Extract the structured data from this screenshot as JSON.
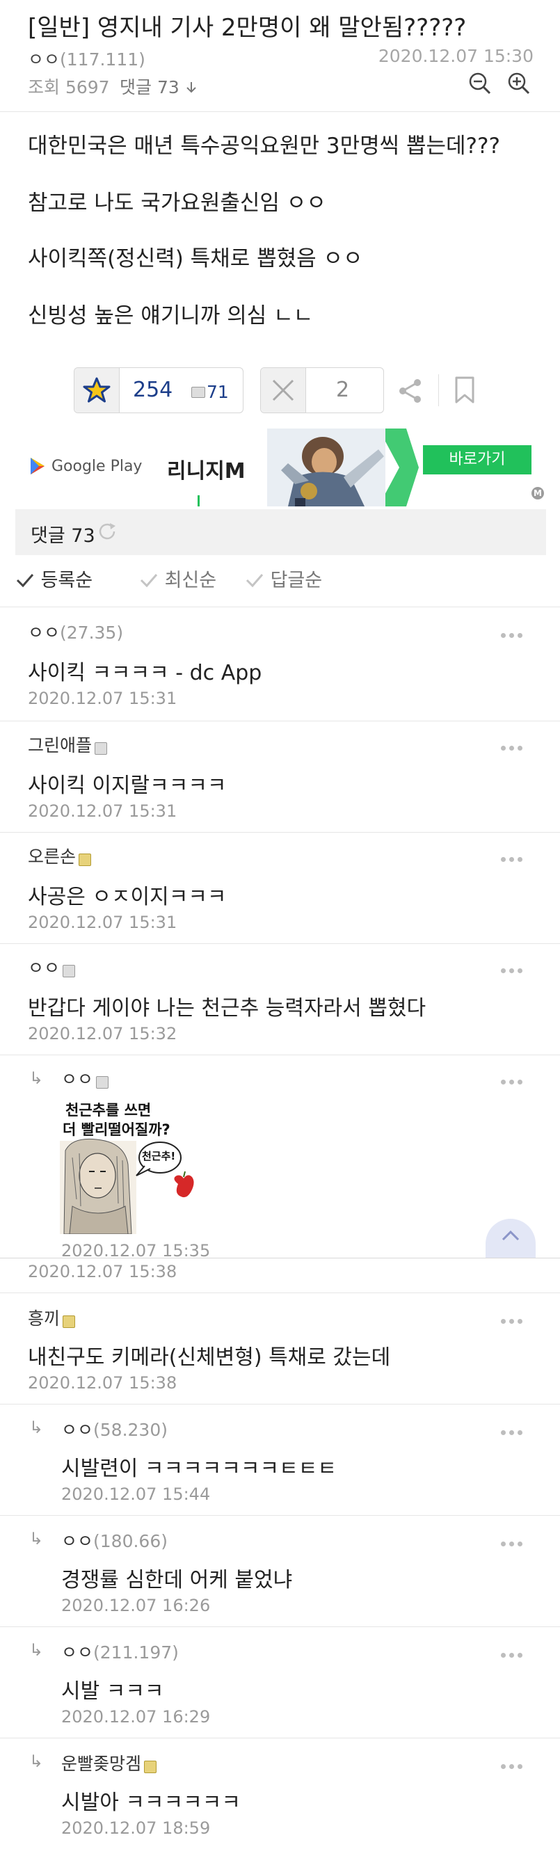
{
  "post": {
    "title": "[일반] 영지내 기사 2만명이 왜 말안됨?????",
    "author_name": "ㅇㅇ",
    "author_ip": "(117.111)",
    "datetime": "2020.12.07 15:30",
    "views": "조회 5697",
    "comment_count_link": "댓글 73",
    "body_lines": [
      "대한민국은 매년 특수공익요원만 3만명씩 뽑는데???",
      "참고로 나도 국가요원출신임 ㅇㅇ",
      "사이킥쪽(정신력) 특채로 뽑혔음 ㅇㅇ",
      "신빙성 높은 얘기니까 의심 ㄴㄴ"
    ]
  },
  "votes": {
    "up_count": "254",
    "fix_count": "71",
    "down_count": "2"
  },
  "ad": {
    "store": "Google Play",
    "title": "리니지M",
    "cta": "바로가기"
  },
  "comments_header": {
    "label": "댓글 73"
  },
  "sort": {
    "options": [
      "등록순",
      "최신순",
      "답글순"
    ]
  },
  "image_comment": {
    "caption_line1": "천근추를 쓰면",
    "caption_line2": "더 빨리떨어질까?",
    "bubble": "천근추!",
    "date": "2020.12.07 15:35",
    "parent_date": "2020.12.07 15:38"
  },
  "comments": [
    {
      "author": "ㅇㅇ",
      "ip": "(27.35)",
      "text": "사이킥 ㅋㅋㅋㅋ - dc App",
      "date": "2020.12.07 15:31",
      "reply": false
    },
    {
      "author": "그린애플",
      "ip": "",
      "text": "사이킥 이지랄ㅋㅋㅋㅋ",
      "date": "2020.12.07 15:31",
      "reply": false
    },
    {
      "author": "오른손",
      "ip": "",
      "text": "사공은 ㅇㅈ이지ㅋㅋㅋ",
      "date": "2020.12.07 15:31",
      "reply": false
    },
    {
      "author": "ㅇㅇ",
      "ip": "",
      "text": "반갑다 게이야 나는 천근추 능력자라서 뽑혔다",
      "date": "2020.12.07 15:32",
      "reply": false
    },
    {
      "author": "ㅇㅇ",
      "ip": "",
      "text": "",
      "date": "",
      "reply": true
    },
    {
      "author": "흥끼",
      "ip": "",
      "text": "내친구도 키메라(신체변형) 특채로 갔는데",
      "date": "2020.12.07 15:38",
      "reply": false
    },
    {
      "author": "ㅇㅇ",
      "ip": "(58.230)",
      "text": "시발련이 ㅋㅋㅋㅋㅋㅋㅋㅌㅌㅌ",
      "date": "2020.12.07 15:44",
      "reply": true
    },
    {
      "author": "ㅇㅇ",
      "ip": "(180.66)",
      "text": "경쟁률 심한데 어케 붙었냐",
      "date": "2020.12.07 16:26",
      "reply": true
    },
    {
      "author": "ㅇㅇ",
      "ip": "(211.197)",
      "text": "시발 ㅋㅋㅋ",
      "date": "2020.12.07 16:29",
      "reply": true
    },
    {
      "author": "운빨좆망겜",
      "ip": "",
      "text": "시발아 ㅋㅋㅋㅋㅋㅋ",
      "date": "2020.12.07 18:59",
      "reply": true
    }
  ],
  "colors": {
    "accent_green": "#21c15b",
    "star_yellow": "#f5c518",
    "star_blue": "#1c3e8a",
    "text_gray": "#9a9a9a"
  },
  "icons": [
    "zoom-out-icon",
    "zoom-in-icon",
    "star-icon",
    "x-icon",
    "share-icon",
    "bookmark-icon",
    "refresh-icon",
    "check-icon",
    "more-icon",
    "reply-arrow-icon",
    "scroll-top-icon",
    "ad-badge-icon",
    "google-play-icon"
  ]
}
